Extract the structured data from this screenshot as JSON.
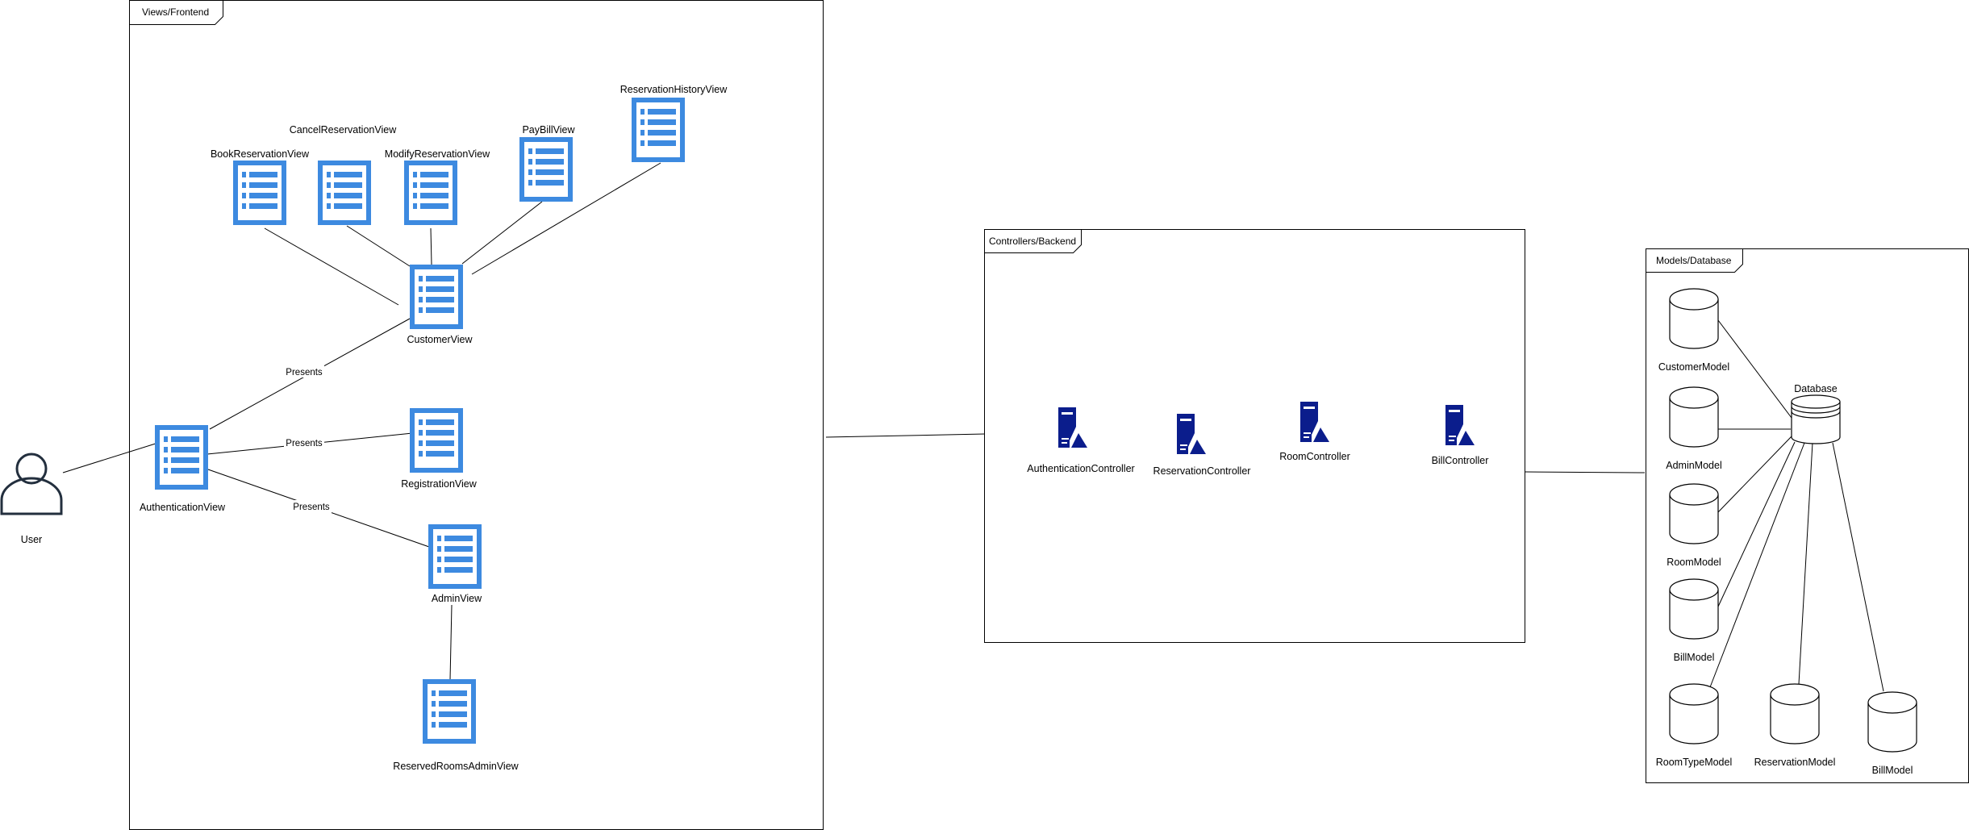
{
  "colors": {
    "view_icon": "#3d8ae0",
    "server_icon": "#0b1d8c",
    "user_icon": "#232f3e",
    "line": "#000000"
  },
  "frames": {
    "views": "Views/Frontend",
    "controllers": "Controllers/Backend",
    "models": "Models/Database"
  },
  "user": {
    "label": "User",
    "icon": "user-icon"
  },
  "views": {
    "icon": "list-view-icon",
    "book_reservation": "BookReservationView",
    "cancel_reservation": "CancelReservationView",
    "modify_reservation": "ModifyReservationView",
    "pay_bill": "PayBillView",
    "reservation_history": "ReservationHistoryView",
    "customer": "CustomerView",
    "registration": "RegistrationView",
    "authentication": "AuthenticationView",
    "admin": "AdminView",
    "reserved_rooms_admin": "ReservedRoomsAdminView"
  },
  "edge_labels": {
    "auth_customer": "Presents",
    "auth_registration": "Presents",
    "auth_admin": "Presents"
  },
  "controllers": {
    "icon": "server-icon",
    "authentication": "AuthenticationController",
    "reservation": "ReservationController",
    "room": "RoomController",
    "bill": "BillController"
  },
  "models": {
    "icon": "cylinder-icon",
    "database": "Database",
    "customer": "CustomerModel",
    "admin": "AdminModel",
    "room": "RoomModel",
    "bill": "BillModel",
    "room_type": "RoomTypeModel",
    "reservation": "ReservationModel",
    "bill_model_2": "BillModel"
  }
}
